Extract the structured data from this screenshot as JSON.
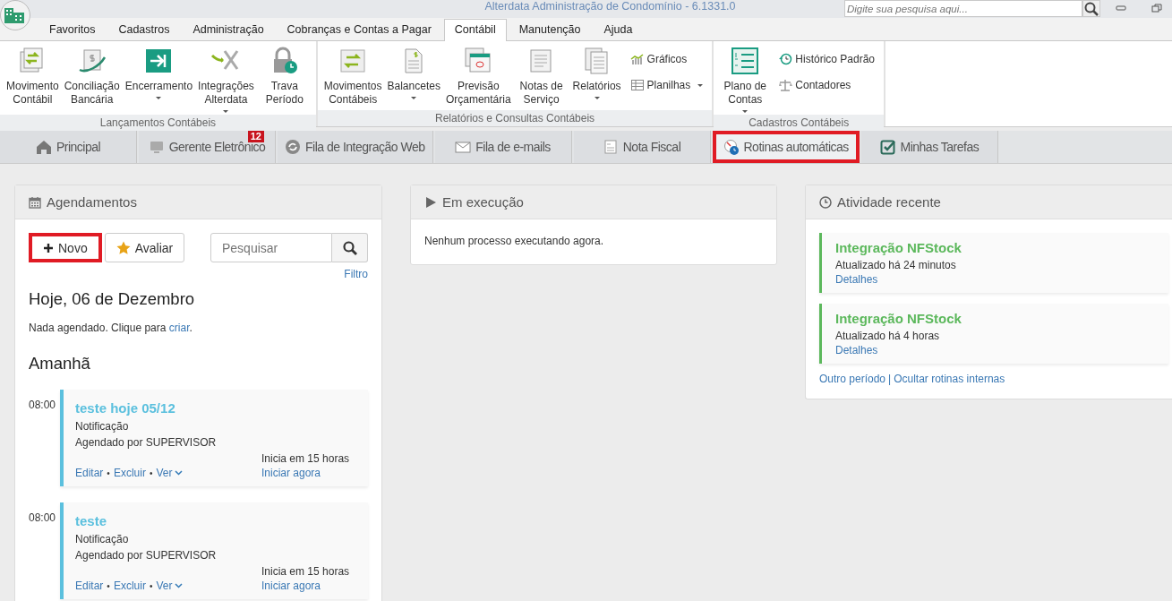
{
  "window": {
    "title": "Alterdata Administração de Condomínio - 6.1331.0",
    "search": {
      "placeholder": "Digite sua pesquisa aqui..."
    }
  },
  "menu_tabs": [
    {
      "label": "Favoritos",
      "selected": false
    },
    {
      "label": "Cadastros",
      "selected": false
    },
    {
      "label": "Administração",
      "selected": false
    },
    {
      "label": "Cobranças e Contas a Pagar",
      "selected": false
    },
    {
      "label": "Contábil",
      "selected": true
    },
    {
      "label": "Manutenção",
      "selected": false
    },
    {
      "label": "Ajuda",
      "selected": false
    }
  ],
  "ribbon_groups": [
    {
      "label": "Lançamentos Contábeis",
      "items": [
        {
          "kind": "large",
          "label": "Movimento\nContábil",
          "dropdown": false
        },
        {
          "kind": "large",
          "label": "Conciliação\nBancária",
          "dropdown": false
        },
        {
          "kind": "large",
          "label": "Encerramento",
          "dropdown": true
        },
        {
          "kind": "large",
          "label": "Integrações\nAlterdata",
          "dropdown": true
        },
        {
          "kind": "large",
          "label": "Trava\nPeríodo",
          "dropdown": false
        }
      ]
    },
    {
      "label": "Relatórios e Consultas Contábeis",
      "items": [
        {
          "kind": "large",
          "label": "Movimentos\nContábeis",
          "dropdown": false
        },
        {
          "kind": "large",
          "label": "Balancetes",
          "dropdown": true
        },
        {
          "kind": "large",
          "label": "Previsão\nOrçamentária",
          "dropdown": false
        },
        {
          "kind": "large",
          "label": "Notas de\nServiço",
          "dropdown": false
        },
        {
          "kind": "large",
          "label": "Relatórios",
          "dropdown": true
        },
        {
          "kind": "small",
          "label": "Gráficos",
          "dropdown": false
        },
        {
          "kind": "small",
          "label": "Planilhas",
          "dropdown": true
        }
      ]
    },
    {
      "label": "Cadastros Contábeis",
      "items": [
        {
          "kind": "large",
          "label": "Plano de\nContas",
          "dropdown": true
        },
        {
          "kind": "small",
          "label": "Histórico Padrão",
          "dropdown": false
        },
        {
          "kind": "small",
          "label": "Contadores",
          "dropdown": false
        }
      ]
    }
  ],
  "page_tabs": [
    {
      "label": "Principal",
      "selected": false,
      "highlighted": false
    },
    {
      "label": "Gerente Eletrônico",
      "badge": "12",
      "selected": false,
      "highlighted": false
    },
    {
      "label": "Fila de Integração Web",
      "selected": false,
      "highlighted": false
    },
    {
      "label": "Fila de e-mails",
      "selected": false,
      "highlighted": false
    },
    {
      "label": "Nota Fiscal",
      "selected": false,
      "highlighted": false
    },
    {
      "label": "Rotinas automáticas",
      "selected": true,
      "highlighted": true
    },
    {
      "label": "Minhas Tarefas",
      "selected": false,
      "highlighted": false
    }
  ],
  "schedules": {
    "title": "Agendamentos",
    "buttons": [
      {
        "kind": "new",
        "label": "Novo",
        "highlighted": true
      },
      {
        "kind": "rate",
        "label": "Avaliar",
        "highlighted": false
      }
    ],
    "search": {
      "placeholder": "Pesquisar"
    },
    "filter_link": "Filtro",
    "days": [
      {
        "title": "Hoje, 06 de Dezembro",
        "empty_text": "Nada agendado. Clique para ",
        "empty_link": "criar",
        "empty_end": "."
      },
      {
        "title": "Amanhã",
        "entries": [
          {
            "time": "08:00",
            "title": "teste hoje 05/12",
            "type": "Notificação",
            "by": "Agendado por SUPERVISOR",
            "starts": "Inicia em 15 horas",
            "start_now": "Iniciar agora",
            "actions": [
              {
                "label": "Editar",
                "dropdown": false
              },
              {
                "label": "Excluir",
                "dropdown": false
              },
              {
                "label": "Ver",
                "dropdown": true
              }
            ],
            "separator": "•"
          },
          {
            "time": "08:00",
            "title": "teste",
            "type": "Notificação",
            "by": "Agendado por SUPERVISOR",
            "starts": "Inicia em 15 horas",
            "start_now": "Iniciar agora",
            "actions": [
              {
                "label": "Editar",
                "dropdown": false
              },
              {
                "label": "Excluir",
                "dropdown": false
              },
              {
                "label": "Ver",
                "dropdown": true
              }
            ],
            "separator": "•"
          }
        ]
      }
    ]
  },
  "running": {
    "title": "Em execução",
    "text": "Nenhum processo executando agora."
  },
  "recent": {
    "title": "Atividade recente",
    "items": [
      {
        "title": "Integração NFStock",
        "time": "Atualizado há 24 minutos",
        "link": "Detalhes"
      },
      {
        "title": "Integração NFStock",
        "time": "Atualizado há 4 horas",
        "link": "Detalhes"
      }
    ],
    "footer_links": [
      "Outro período",
      "Ocultar rotinas internas"
    ],
    "footer_separator": "|"
  }
}
